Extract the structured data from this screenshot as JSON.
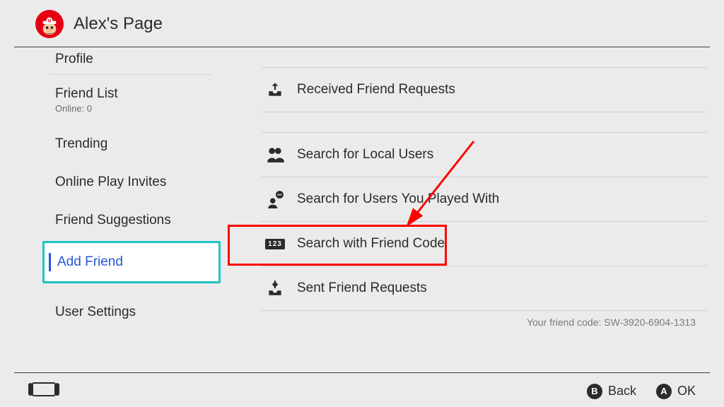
{
  "header": {
    "title": "Alex's Page"
  },
  "sidebar": {
    "items": [
      {
        "label": "Profile"
      },
      {
        "label": "Friend List",
        "sub": "Online: 0"
      },
      {
        "label": "Trending"
      },
      {
        "label": "Online Play Invites"
      },
      {
        "label": "Friend Suggestions"
      },
      {
        "label": "Add Friend"
      },
      {
        "label": "User Settings"
      }
    ]
  },
  "main": {
    "rows": [
      {
        "label": "Received Friend Requests"
      },
      {
        "label": "Search for Local Users"
      },
      {
        "label": "Search for Users You Played With"
      },
      {
        "label": "Search with Friend Code",
        "badge": "123"
      },
      {
        "label": "Sent Friend Requests"
      }
    ],
    "friend_code_label": "Your friend code: SW-3920-6904-1313"
  },
  "footer": {
    "back_label": "Back",
    "back_button": "B",
    "ok_label": "OK",
    "ok_button": "A"
  }
}
